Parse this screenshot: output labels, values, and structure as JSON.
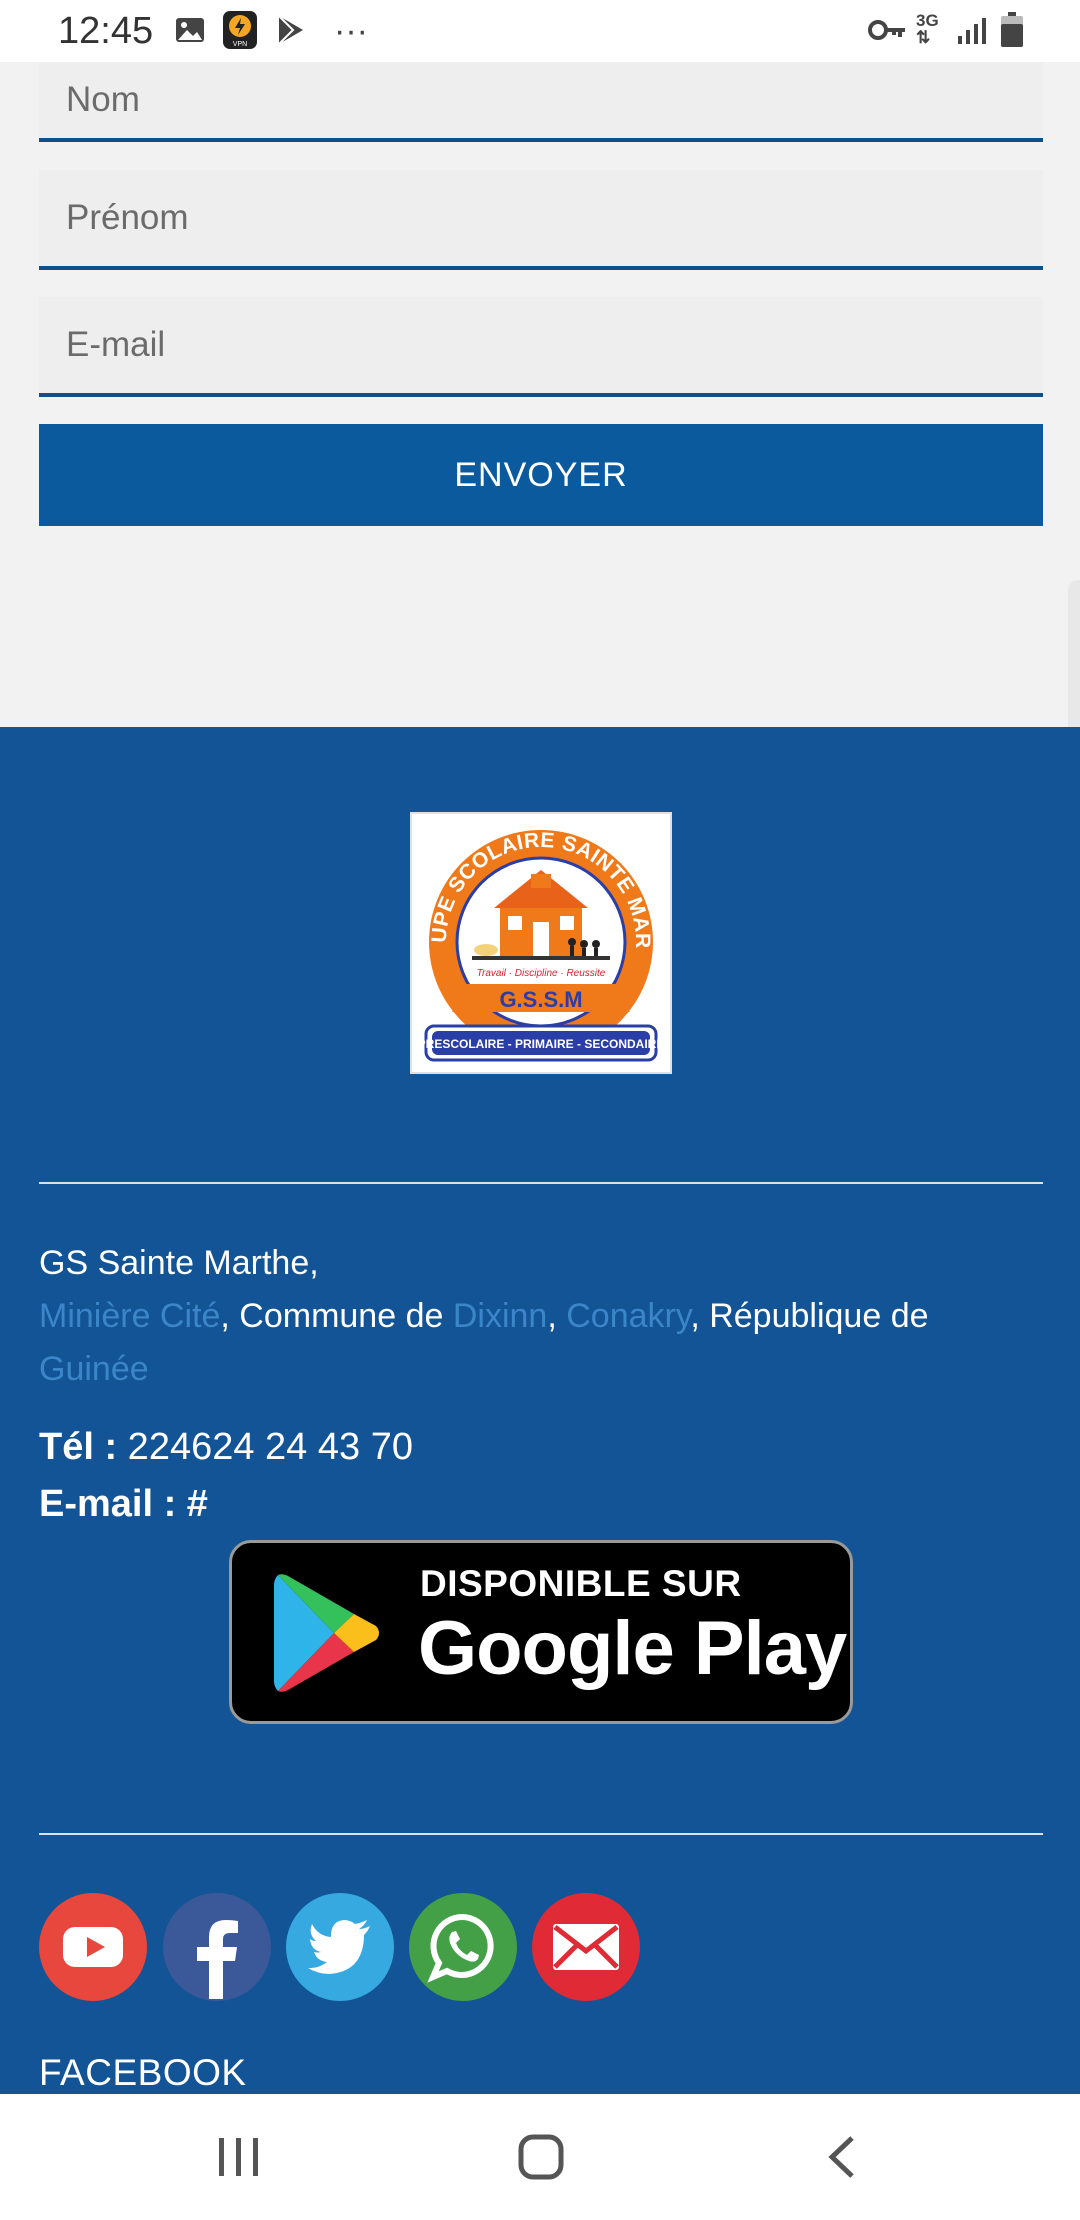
{
  "status_bar": {
    "time": "12:45",
    "network": "3G",
    "icons": [
      "image-icon",
      "vpn-icon",
      "play-store-icon",
      "more-dots-icon",
      "key-icon",
      "signal-icon",
      "battery-icon"
    ]
  },
  "form": {
    "nom_placeholder": "Nom",
    "prenom_placeholder": "Prénom",
    "email_placeholder": "E-mail",
    "submit_label": "ENVOYER"
  },
  "footer": {
    "logo": {
      "arc_text": "GROUPE SCOLAIRE SAINTE MARTHE",
      "motto": "Travail · Discipline · Reussite",
      "acronym": "G.S.S.M",
      "levels": "PRESCOLAIRE - PRIMAIRE - SECONDAIRE"
    },
    "address": {
      "name": "GS Sainte Marthe,",
      "quarter": "Minière Cité",
      "sep1": ", Commune de ",
      "commune": "Dixinn",
      "sep2": ", ",
      "city": "Conakry",
      "sep3": ", République de ",
      "country": "Guinée"
    },
    "phone_label": "Tél :",
    "phone_value": " 224624 24 43 70",
    "email_label": "E-mail :",
    "email_value": " #",
    "play_badge": {
      "top": "DISPONIBLE SUR",
      "bottom": "Google Play"
    },
    "social_icons": [
      "youtube-icon",
      "facebook-icon",
      "twitter-icon",
      "whatsapp-icon",
      "mail-icon"
    ],
    "facebook_title": "FACEBOOK"
  },
  "colors": {
    "footer_bg": "#125496",
    "button_bg": "#0b5a9e",
    "link": "#3a86c8",
    "youtube": "#e7473d",
    "facebook": "#3b5998",
    "twitter": "#35a9e0",
    "whatsapp": "#43a047",
    "mail": "#e02b36"
  },
  "nav_bar": {
    "icons": [
      "recent-apps-icon",
      "home-icon",
      "back-icon"
    ]
  }
}
